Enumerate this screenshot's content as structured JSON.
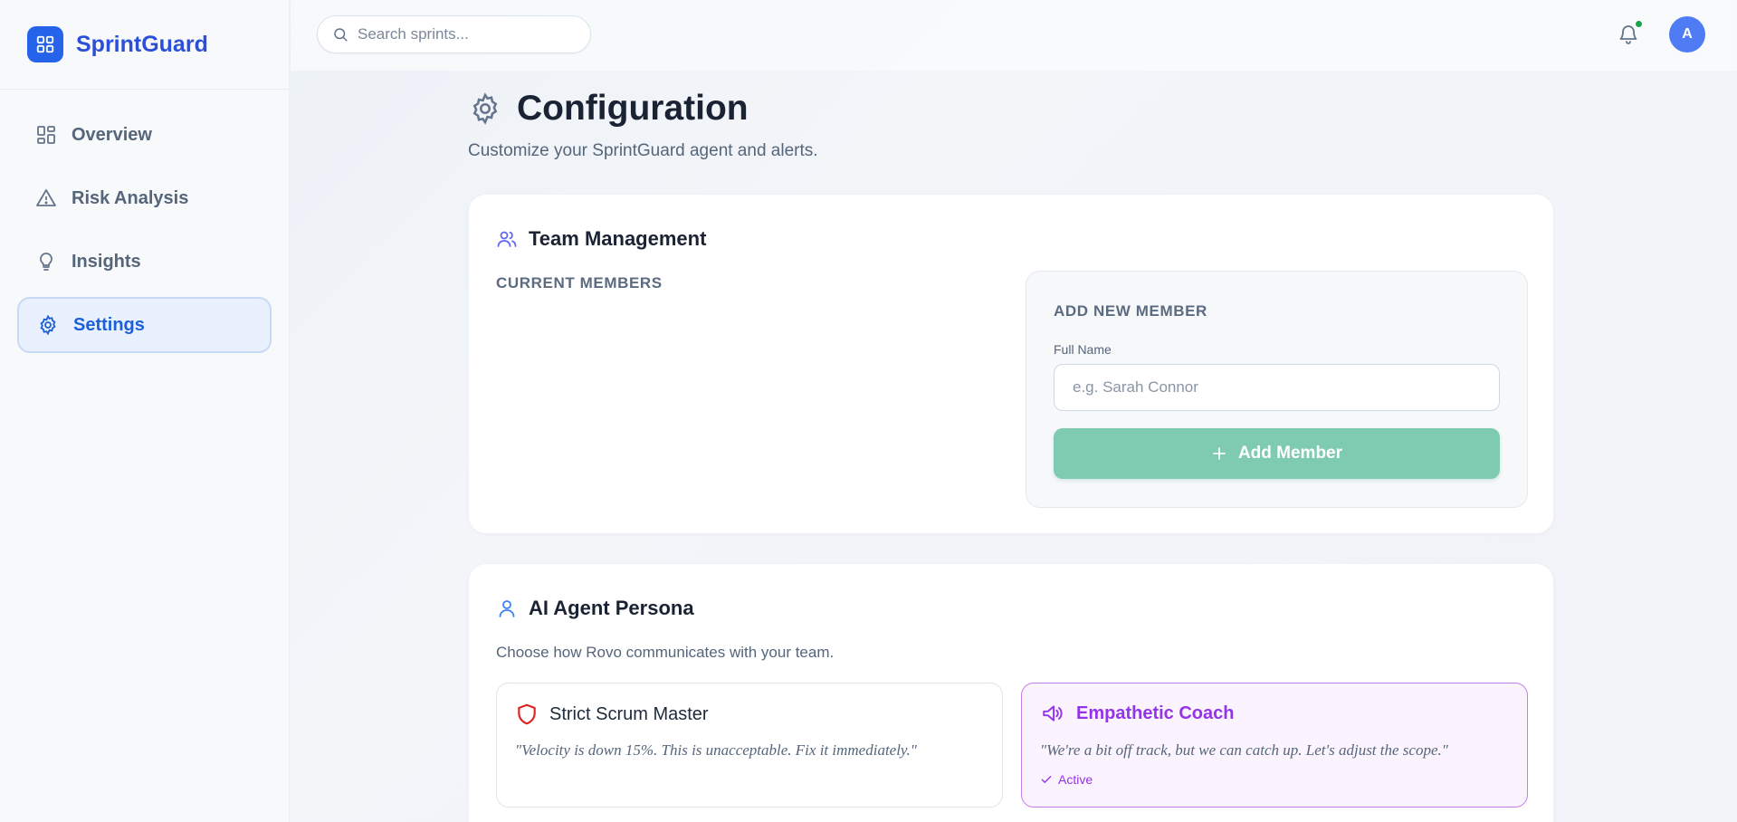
{
  "app": {
    "name": "SprintGuard",
    "colors": {
      "brand": "#2563eb",
      "accent_green": "#7ecbb1",
      "persona_active": "#9333ea"
    }
  },
  "sidebar": {
    "items": [
      {
        "label": "Overview",
        "icon": "dashboard-icon",
        "active": false
      },
      {
        "label": "Risk Analysis",
        "icon": "warning-triangle-icon",
        "active": false
      },
      {
        "label": "Insights",
        "icon": "lightbulb-icon",
        "active": false
      },
      {
        "label": "Settings",
        "icon": "gear-icon",
        "active": true
      }
    ]
  },
  "header": {
    "search_placeholder": "Search sprints...",
    "avatar_initial": "A",
    "notification_dot": true
  },
  "page": {
    "title": "Configuration",
    "subtitle": "Customize your SprintGuard agent and alerts."
  },
  "team": {
    "title": "Team Management",
    "current_members_label": "CURRENT MEMBERS",
    "add_section_label": "ADD NEW MEMBER",
    "full_name_label": "Full Name",
    "full_name_placeholder": "e.g. Sarah Connor",
    "add_button_label": "Add Member"
  },
  "persona": {
    "title": "AI Agent Persona",
    "description": "Choose how Rovo communicates with your team.",
    "options": [
      {
        "name": "Strict Scrum Master",
        "quote": "\"Velocity is down 15%. This is unacceptable. Fix it immediately.\"",
        "active": false
      },
      {
        "name": "Empathetic Coach",
        "quote": "\"We're a bit off track, but we can catch up. Let's adjust the scope.\"",
        "status": "Active",
        "active": true
      }
    ]
  }
}
